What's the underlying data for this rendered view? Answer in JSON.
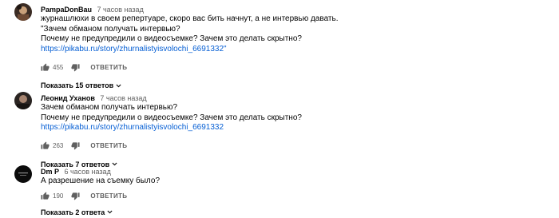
{
  "comments": [
    {
      "author": "PampaDonBau",
      "time": "7 часов назад",
      "lines": [
        "журнашлюхи в своем репертуаре, скоро вас бить начнут, а не интервью давать.",
        "\"Зачем обманом получать интервью?",
        "Почему не предупредили о видеосъемке? Зачем это делать скрытно?"
      ],
      "link": "https://pikabu.ru/story/zhurnalistyisvolochi_6691332\"",
      "likes": "455",
      "reply_label": "ОТВЕТИТЬ",
      "show_replies": "Показать 15 ответов"
    },
    {
      "author": "Леонид Уханов",
      "time": "7 часов назад",
      "lines": [
        "Зачем обманом получать интервью?",
        "Почему не предупредили о видеосъемке? Зачем это делать скрытно?"
      ],
      "link": "https://pikabu.ru/story/zhurnalistyisvolochi_6691332",
      "likes": "263",
      "reply_label": "ОТВЕТИТЬ",
      "show_replies": "Показать 7 ответов"
    },
    {
      "author": "Dm P",
      "time": "6 часов назад",
      "lines": [
        "А разрешение на съемку было?"
      ],
      "likes": "190",
      "reply_label": "ОТВЕТИТЬ",
      "show_replies": "Показать 2 ответа"
    }
  ]
}
